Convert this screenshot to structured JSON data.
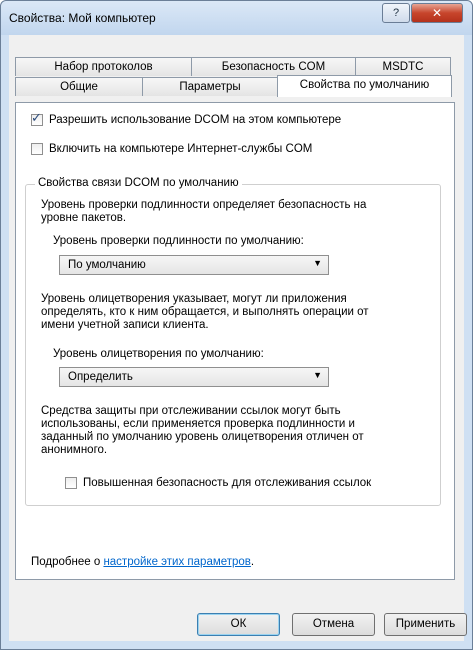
{
  "window": {
    "title": "Свойства: Мой компьютер",
    "help": "?",
    "close": "✕"
  },
  "tabs_row1": [
    "Набор протоколов",
    "Безопасность COM",
    "MSDTC"
  ],
  "tabs_row2": [
    "Общие",
    "Параметры",
    "Свойства по умолчанию"
  ],
  "checkboxes": {
    "enable_dcom": {
      "label": "Разрешить использование DCOM на этом компьютере",
      "checked": true
    },
    "enable_com_internet": {
      "label": "Включить на компьютере Интернет-службы COM",
      "checked": false
    }
  },
  "group": {
    "title": "Свойства связи DCOM по умолчанию",
    "auth_desc": [
      "Уровень проверки подлинности определяет безопасность на",
      "уровне пакетов."
    ],
    "auth_label": "Уровень проверки подлинности по умолчанию:",
    "auth_value": "По умолчанию",
    "imp_desc": [
      "Уровень олицетворения указывает, могут ли приложения",
      "определять, кто к ним обращается, и выполнять операции от",
      "имени учетной записи клиента."
    ],
    "imp_label": "Уровень олицетворения по умолчанию:",
    "imp_value": "Определить",
    "ref_desc": [
      "Средства защиты при отслеживании ссылок могут быть",
      "использованы, если применяется проверка подлинности и",
      "заданный по умолчанию уровень олицетворения отличен от",
      "анонимного."
    ],
    "ref_checkbox": {
      "label": "Повышенная безопасность для отслеживания ссылок",
      "checked": false
    }
  },
  "footer_text": {
    "prefix": "Подробнее о ",
    "link": "настройке этих параметров",
    "suffix": "."
  },
  "buttons": {
    "ok": "ОК",
    "cancel": "Отмена",
    "apply": "Применить"
  }
}
